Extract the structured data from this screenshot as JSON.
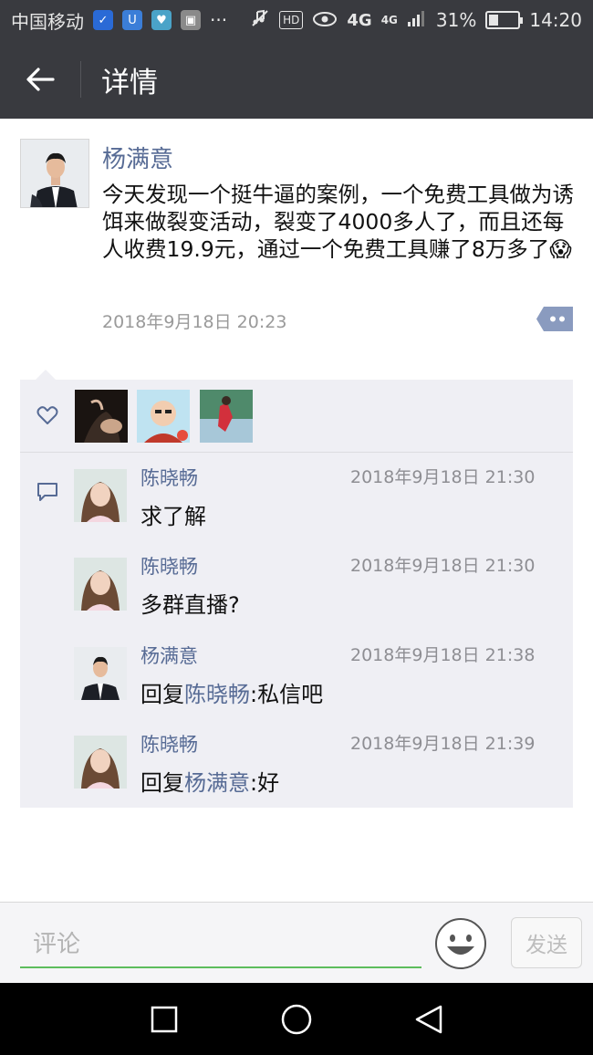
{
  "status_bar": {
    "carrier": "中国移动",
    "more": "···",
    "hd": "HD",
    "net1": "4G",
    "net2": "4G",
    "battery": "31%",
    "battery_level": 0.31,
    "time": "14:20"
  },
  "header": {
    "title": "详情",
    "bg_color": "#393a3f"
  },
  "post": {
    "author": "杨满意",
    "text": "今天发现一个挺牛逼的案例，一个免费工具做为诱饵来做裂变活动，裂变了4000多人了，而且还每人收费19.9元，通过一个免费工具赚了8万多了",
    "emoji": "😱",
    "time": "2018年9月18日 20:23"
  },
  "likes": {
    "icon": "heart-outline-icon",
    "users": [
      "liker-1",
      "liker-2",
      "liker-3"
    ]
  },
  "comments": [
    {
      "name": "陈晓畅",
      "time": "2018年9月18日 21:30",
      "prefix": "",
      "mention": "",
      "body": "求了解"
    },
    {
      "name": "陈晓畅",
      "time": "2018年9月18日 21:30",
      "prefix": "",
      "mention": "",
      "body": "多群直播?"
    },
    {
      "name": "杨满意",
      "time": "2018年9月18日 21:38",
      "prefix": "回复",
      "mention": "陈晓畅",
      "body": ":私信吧"
    },
    {
      "name": "陈晓畅",
      "time": "2018年9月18日 21:39",
      "prefix": "回复",
      "mention": "杨满意",
      "body": ":好"
    }
  ],
  "input": {
    "placeholder": "评论",
    "value": "",
    "send_label": "发送"
  },
  "colors": {
    "link": "#576b95",
    "input_underline": "#5dbd5d",
    "panel": "#efeff4"
  }
}
